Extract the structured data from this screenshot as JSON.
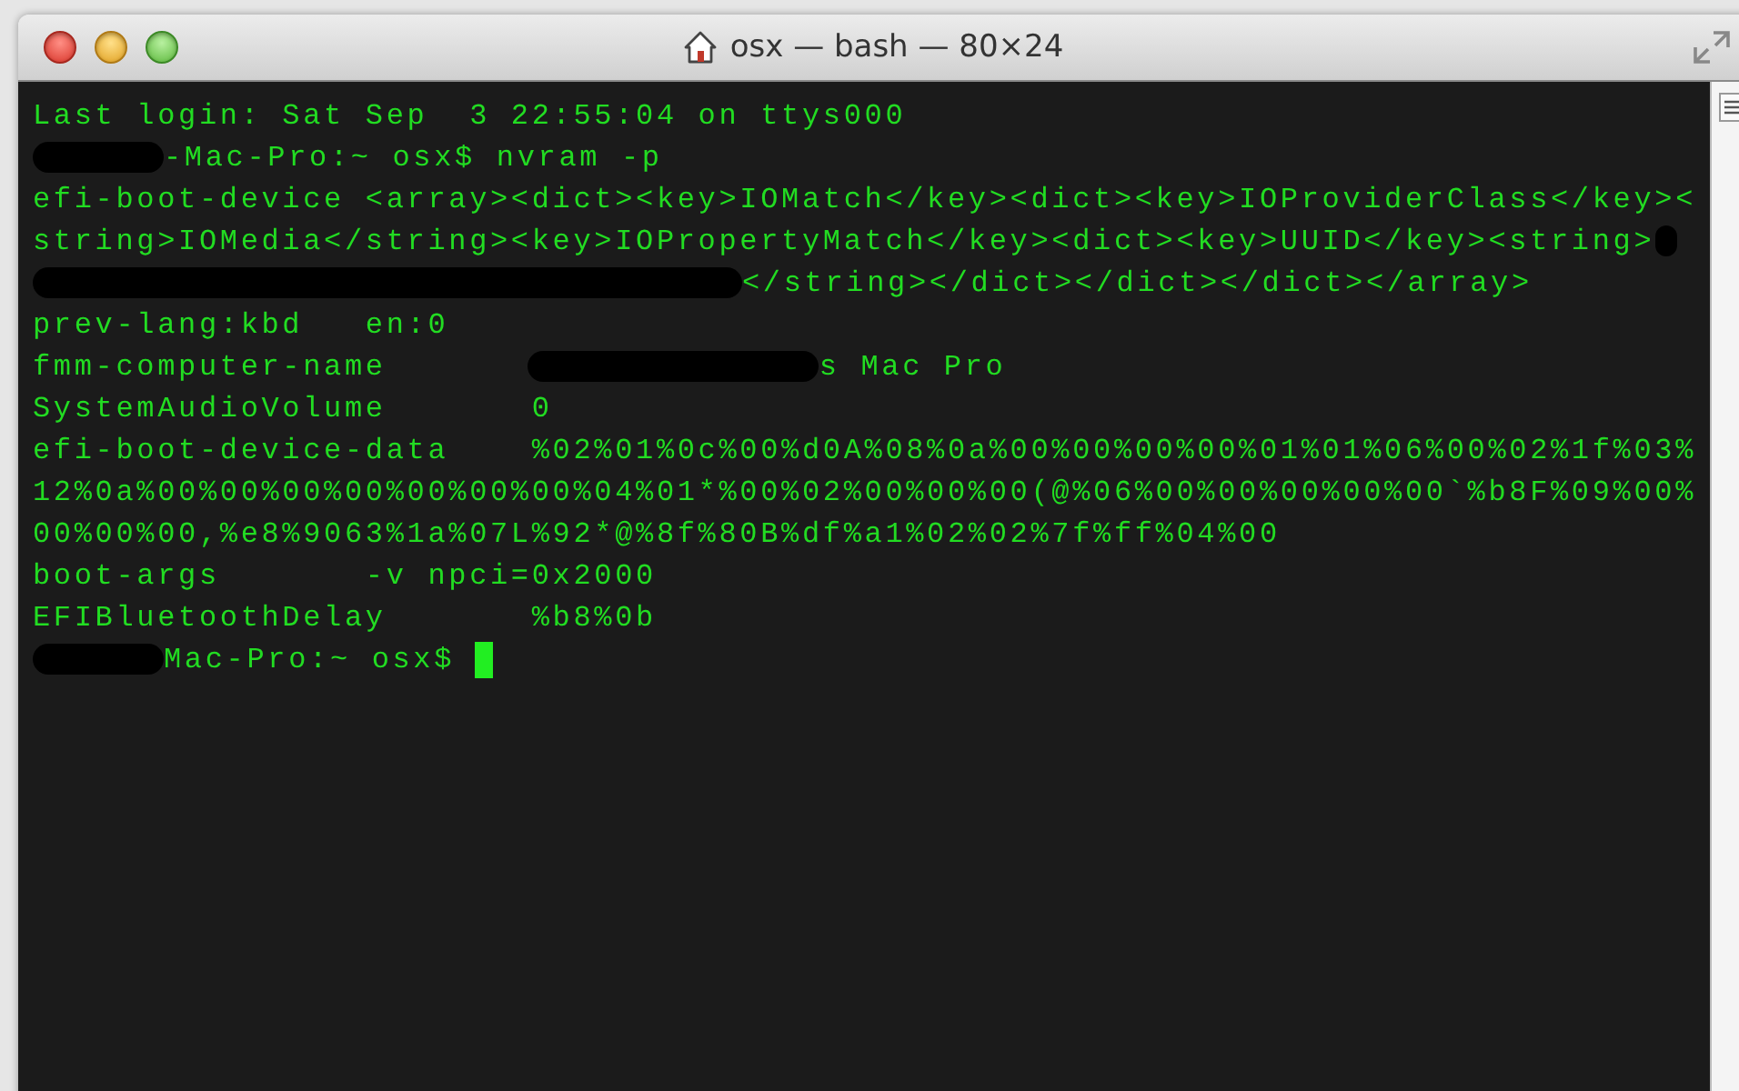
{
  "window": {
    "title": "osx — bash — 80×24"
  },
  "terminal": {
    "lines": [
      {
        "segments": [
          {
            "kind": "text",
            "text": "Last login: Sat Sep  3 22:55:04 on ttys000"
          }
        ]
      },
      {
        "segments": [
          {
            "kind": "short_redaction"
          },
          {
            "kind": "text",
            "text": "-Mac-Pro:~ osx$ nvram -p"
          }
        ]
      },
      {
        "segments": [
          {
            "kind": "text",
            "text": "efi-boot-device <array><dict><key>IOMatch</key><dict><key>IOProviderClass</key><"
          }
        ]
      },
      {
        "segments": [
          {
            "kind": "text",
            "text": "string>IOMedia</string><key>IOPropertyMatch</key><dict><key>UUID</key><string>"
          },
          {
            "kind": "tiny_redaction"
          }
        ]
      },
      {
        "segments": [
          {
            "kind": "long_redaction"
          },
          {
            "kind": "text",
            "text": "</string></dict></dict></dict></array>"
          }
        ]
      },
      {
        "segments": [
          {
            "kind": "text",
            "text": "prev-lang:kbd   en:0"
          }
        ]
      },
      {
        "segments": [
          {
            "kind": "text",
            "text": "fmm-computer-name"
          },
          {
            "kind": "medium_redaction"
          },
          {
            "kind": "text",
            "text": "s Mac Pro"
          }
        ]
      },
      {
        "segments": [
          {
            "kind": "text",
            "text": "SystemAudioVolume       0"
          }
        ]
      },
      {
        "segments": [
          {
            "kind": "text",
            "text": "efi-boot-device-data    %02%01%0c%00%d0A%08%0a%00%00%00%00%01%01%06%00%02%1f%03%"
          }
        ]
      },
      {
        "segments": [
          {
            "kind": "text",
            "text": "12%0a%00%00%00%00%00%00%00%04%01*%00%02%00%00%00(@%06%00%00%00%00%00`%b8F%09%00%"
          }
        ]
      },
      {
        "segments": [
          {
            "kind": "text",
            "text": "00%00%00,%e8%9063%1a%07L%92*@%8f%80B%df%a1%02%02%7f%ff%04%00"
          }
        ]
      },
      {
        "segments": [
          {
            "kind": "text",
            "text": "boot-args       -v npci=0x2000"
          }
        ]
      },
      {
        "segments": [
          {
            "kind": "text",
            "text": "EFIBluetoothDelay       %b8%0b"
          }
        ]
      },
      {
        "segments": [
          {
            "kind": "short_redaction"
          },
          {
            "kind": "text",
            "text": "Mac-Pro:~ osx$ "
          },
          {
            "kind": "cursor"
          }
        ]
      }
    ]
  }
}
